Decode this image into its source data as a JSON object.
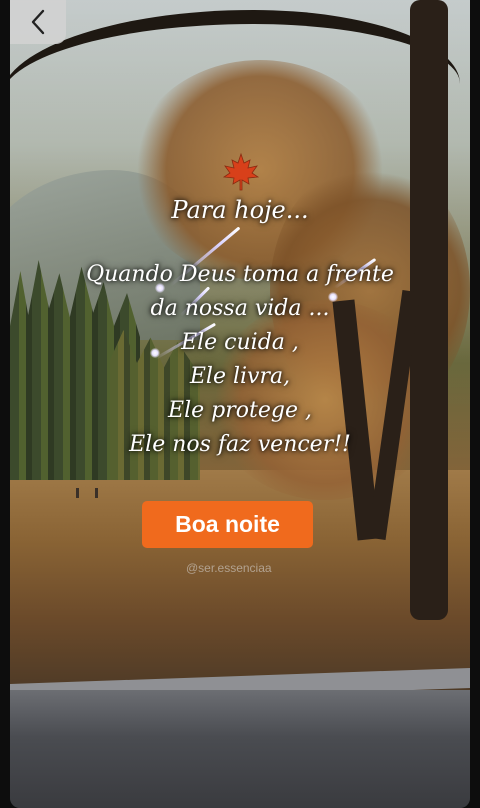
{
  "header": {
    "back_icon": "chevron-left-icon"
  },
  "post": {
    "decor_icon": "maple-leaf-icon",
    "title": "Para hoje...",
    "lines": [
      "Quando Deus toma a frente",
      "da nossa vida ...",
      "Ele cuida ,",
      "Ele livra,",
      "Ele protege ,",
      "Ele nos  faz vencer!!"
    ],
    "button_label": "Boa noite",
    "watermark": "@ser.essenciaa"
  },
  "colors": {
    "button": "#f06a1d",
    "back_button": "#d2d2d2"
  }
}
